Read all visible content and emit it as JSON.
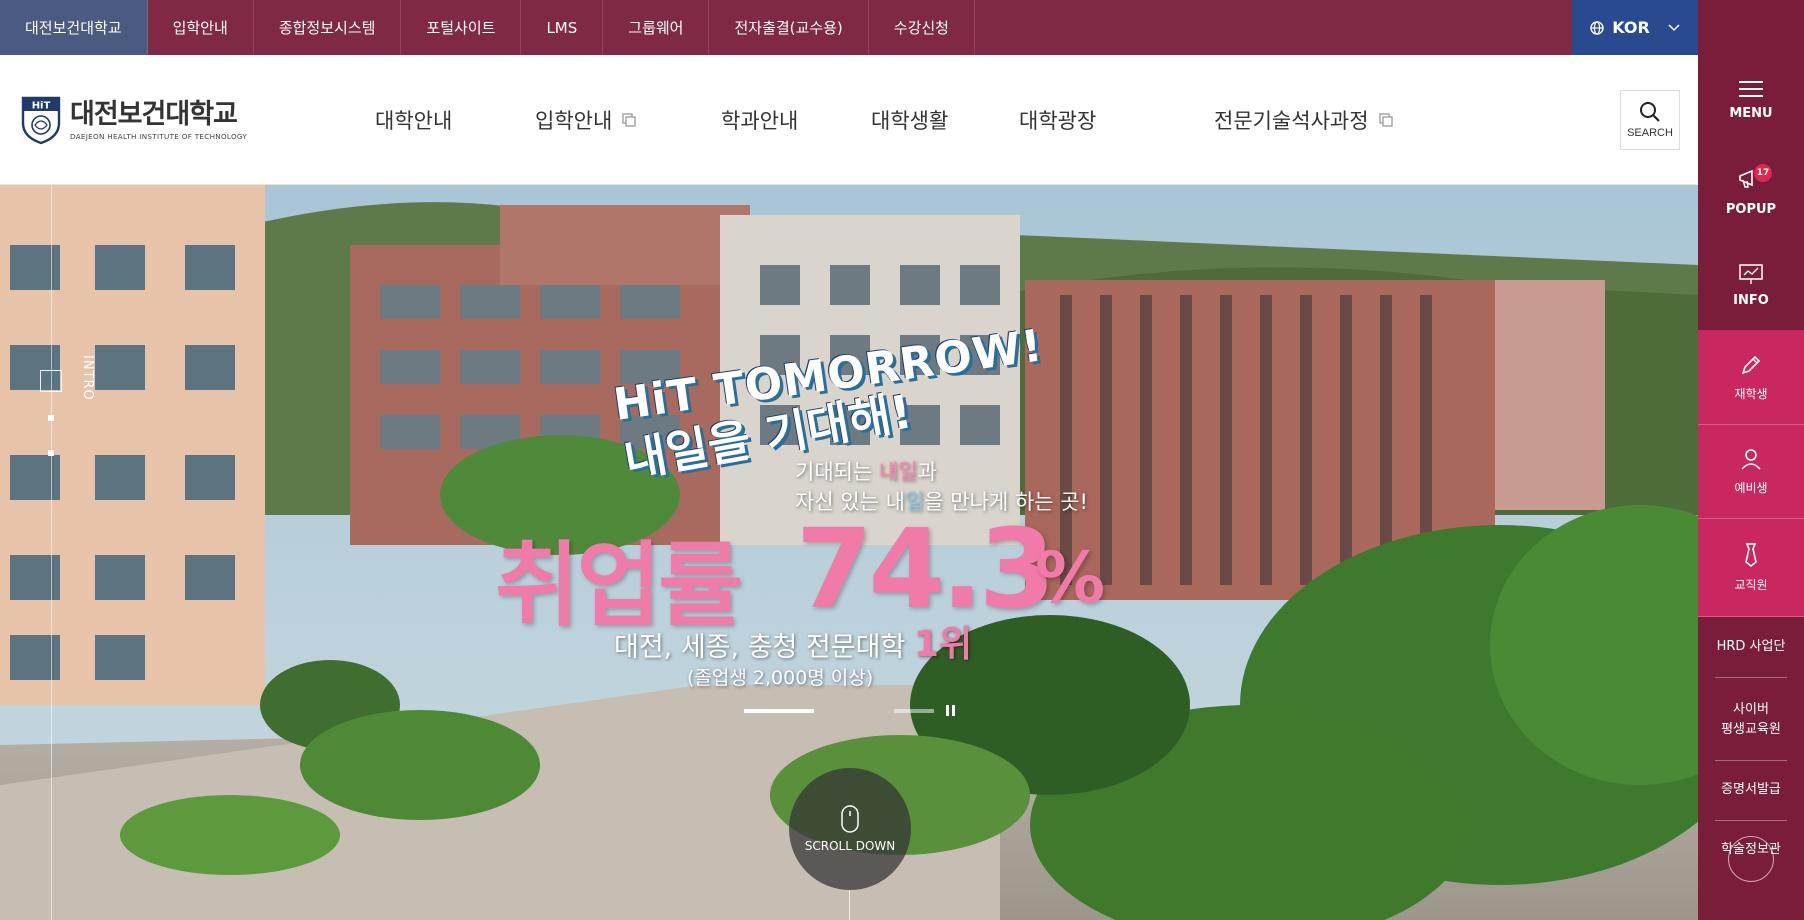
{
  "topbar": {
    "items": [
      "대전보건대학교",
      "입학안내",
      "종합정보시스템",
      "포털사이트",
      "LMS",
      "그룹웨어",
      "전자출결(교수용)",
      "수강신청"
    ],
    "lang": "KOR"
  },
  "header": {
    "logo_badge": "HiT",
    "logo_kr": "대전보건대학교",
    "logo_en": "DAEJEON HEALTH INSTITUTE OF TECHNOLOGY",
    "nav": [
      "대학안내",
      "입학안내",
      "학과안내",
      "대학생활",
      "대학광장",
      "전문기술석사과정"
    ],
    "search_label": "SEARCH"
  },
  "sidebar": {
    "menu": "MENU",
    "popup": "POPUP",
    "popup_count": "17",
    "info": "INFO",
    "quick": [
      {
        "label": "재학생",
        "icon": "pen-icon"
      },
      {
        "label": "예비생",
        "icon": "user-icon"
      },
      {
        "label": "교직원",
        "icon": "tie-icon"
      }
    ],
    "links": [
      "HRD 사업단",
      "사이버\n평생교육원",
      "증명서발급",
      "학술정보관"
    ]
  },
  "hero": {
    "intro_label": "INTRO",
    "slogan_en": "HiT TOMORROW!",
    "slogan_kr": "내일을 기대해!",
    "tagline_1a": "기대되는 ",
    "tagline_1b": "내일",
    "tagline_1c": "과",
    "tagline_2a": "자신 있는 내",
    "tagline_2b": "일",
    "tagline_2c": "을 만나게 하는 곳!",
    "rate_label": "취업률",
    "rate_value": "74.3",
    "rate_unit": "%",
    "rank_text": "대전, 세종, 충청 전문대학 ",
    "rank_num": "1위",
    "rank_note": "(졸업생 2,000명 이상)",
    "scroll_label": "SCROLL DOWN"
  },
  "colors": {
    "topbar": "#7f2944",
    "sidebar": "#7a1d3a",
    "sidebar_highlight": "#c8275f",
    "lang": "#2a4a8f",
    "accent_pink": "#f07aa8"
  }
}
